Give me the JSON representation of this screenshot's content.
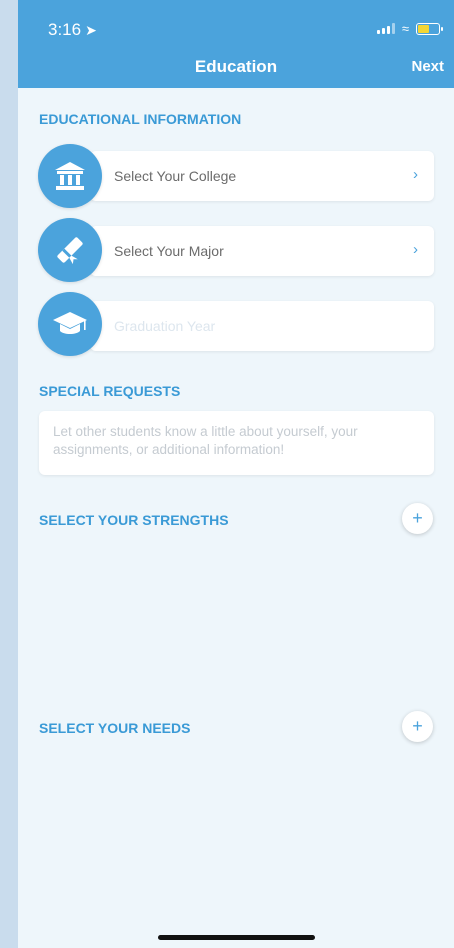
{
  "status_bar": {
    "time": "3:16",
    "location_icon": "location-arrow-icon",
    "battery_color": "#f3d635"
  },
  "header": {
    "title": "Education",
    "next_label": "Next"
  },
  "colors": {
    "accent": "#4ba3dc",
    "section_label": "#3a9ad6",
    "background": "#eef6fb"
  },
  "educational_information": {
    "label": "EDUCATIONAL INFORMATION",
    "college": {
      "placeholder": "Select Your College",
      "icon": "bank-icon"
    },
    "major": {
      "placeholder": "Select Your Major",
      "icon": "diploma-icon"
    },
    "graduation": {
      "placeholder": "Graduation Year",
      "icon": "graduation-cap-icon"
    }
  },
  "special_requests": {
    "label": "SPECIAL REQUESTS",
    "placeholder": "Let other students know a little about yourself, your assignments, or additional information!"
  },
  "strengths": {
    "label": "SELECT YOUR STRENGTHS",
    "add_label": "+"
  },
  "needs": {
    "label": "SELECT YOUR NEEDS",
    "add_label": "+"
  }
}
